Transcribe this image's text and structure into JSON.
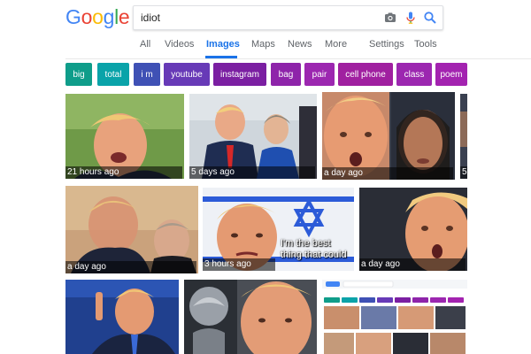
{
  "logo": {
    "letters": [
      "G",
      "o",
      "o",
      "g",
      "l",
      "e"
    ],
    "colors": [
      "#4285f4",
      "#ea4335",
      "#fbbc05",
      "#4285f4",
      "#34a853",
      "#ea4335"
    ]
  },
  "search": {
    "query": "idiot",
    "camera_icon": "camera-icon",
    "mic_icon": "microphone-icon",
    "search_icon": "search-icon"
  },
  "tabs": {
    "all": "All",
    "videos": "Videos",
    "images": "Images",
    "maps": "Maps",
    "news": "News",
    "more": "More",
    "settings": "Settings",
    "tools": "Tools",
    "active": "images",
    "accent": "#1a73e8"
  },
  "chips": [
    {
      "label": "big",
      "color": "#0f9d8a"
    },
    {
      "label": "total",
      "color": "#0aa3a9"
    },
    {
      "label": "i m",
      "color": "#3f51b5"
    },
    {
      "label": "youtube",
      "color": "#673ab7"
    },
    {
      "label": "instagram",
      "color": "#7b1fa2"
    },
    {
      "label": "bag",
      "color": "#8e24aa"
    },
    {
      "label": "pair",
      "color": "#9c27b0"
    },
    {
      "label": "cell phone",
      "color": "#a020a0"
    },
    {
      "label": "class",
      "color": "#9c27b0"
    },
    {
      "label": "poem",
      "color": "#a323b0"
    }
  ],
  "results": [
    {
      "caption": "21 hours ago"
    },
    {
      "caption": "5 days ago"
    },
    {
      "caption": "a day ago"
    },
    {
      "caption": "5"
    },
    {
      "caption": "a day ago"
    },
    {
      "caption": "3 hours ago",
      "overlay": [
        "I'm the best",
        "thing that could"
      ]
    },
    {
      "caption": "a day ago"
    }
  ]
}
